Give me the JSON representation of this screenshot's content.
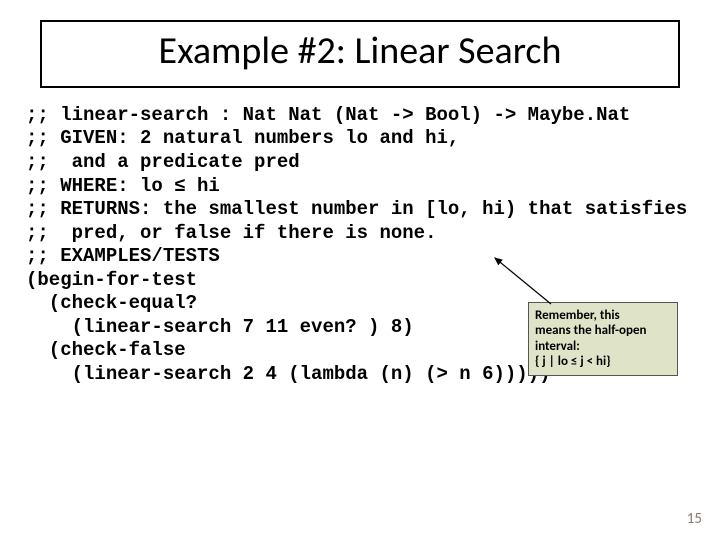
{
  "title": "Example #2: Linear Search",
  "code": {
    "l1": ";; linear-search : Nat Nat (Nat -> Bool) -> Maybe.Nat",
    "l2": ";; GIVEN: 2 natural numbers lo and hi,",
    "l3": ";;  and a predicate pred",
    "l4": ";; WHERE: lo ≤ hi",
    "l5": ";; RETURNS: the smallest number in [lo, hi) that satisfies",
    "l6": ";;  pred, or false if there is none.",
    "l7": ";; EXAMPLES/TESTS",
    "l8": "(begin-for-test",
    "l9": "  (check-equal?",
    "l10": "    (linear-search 7 11 even? ) 8)",
    "l11": "  (check-false",
    "l12": "    (linear-search 2 4 (lambda (n) (> n 6)))))"
  },
  "callout": {
    "line1": "Remember, this",
    "line2": "means the half-open",
    "line3": "interval:",
    "line4": "{ j | lo ≤ j < hi}"
  },
  "page_number": "15"
}
